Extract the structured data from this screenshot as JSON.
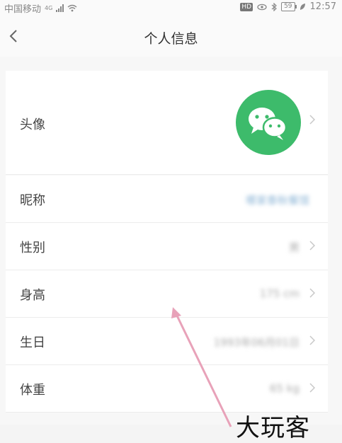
{
  "status_bar": {
    "carrier": "中国移动",
    "network": "4G",
    "hd": "HD",
    "battery": "59",
    "time": "12:57"
  },
  "header": {
    "title": "个人信息",
    "back_icon": "chevron-left-icon"
  },
  "profile": {
    "rows": [
      {
        "label": "头像",
        "value": ""
      },
      {
        "label": "昵称",
        "value": "哪家泰秋餐馆"
      },
      {
        "label": "性别",
        "value": "男"
      },
      {
        "label": "身高",
        "value": "175 cm"
      },
      {
        "label": "生日",
        "value": "1993年06月01日"
      },
      {
        "label": "体重",
        "value": "65 kg"
      }
    ]
  },
  "avatar": {
    "icon": "wechat-logo-icon",
    "color": "#3dbb6b"
  },
  "watermark": {
    "text": "大玩客"
  },
  "colors": {
    "accent": "#3dbb6b",
    "arrow": "#e8a2b9"
  }
}
